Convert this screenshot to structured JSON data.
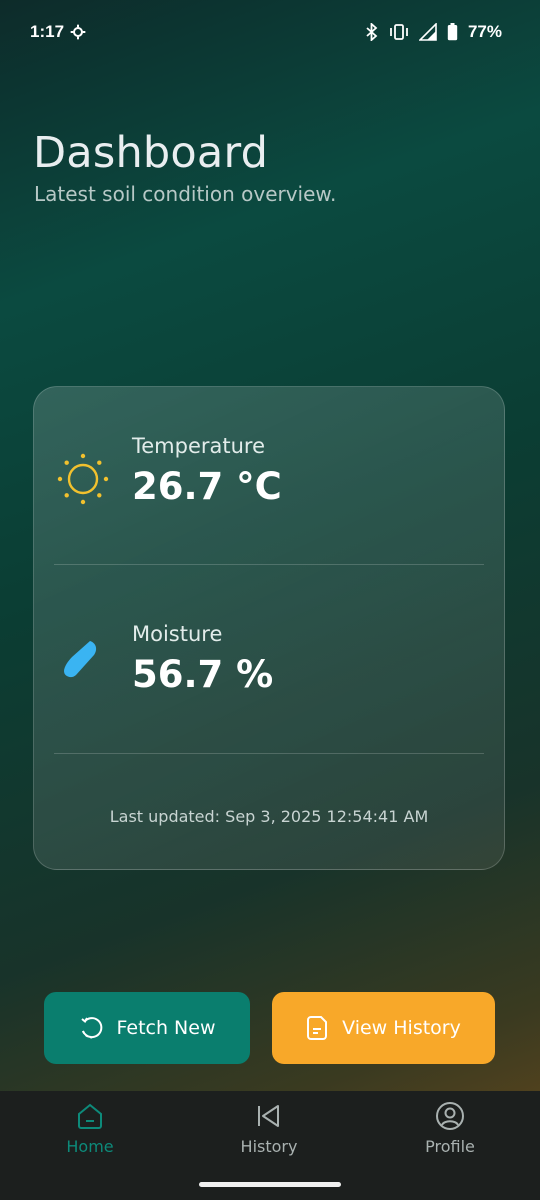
{
  "status_bar": {
    "time": "1:17",
    "battery": "77%",
    "icons": [
      "settings-gear-icon",
      "bluetooth-icon",
      "vibrate-icon",
      "signal-icon",
      "battery-icon"
    ]
  },
  "header": {
    "title": "Dashboard",
    "subtitle": "Latest soil condition overview."
  },
  "card": {
    "temperature": {
      "label": "Temperature",
      "value": "26.7 °C",
      "icon": "sun-icon",
      "color": "#f2c12e"
    },
    "moisture": {
      "label": "Moisture",
      "value": "56.7 %",
      "icon": "water-drop-icon",
      "color": "#3ab4f2"
    },
    "last_updated": "Last updated: Sep 3, 2025 12:54:41 AM"
  },
  "actions": {
    "fetch": {
      "label": "Fetch New",
      "icon": "refresh-icon",
      "color": "#0a7e6e"
    },
    "history": {
      "label": "View History",
      "icon": "document-icon",
      "color": "#f8a829"
    }
  },
  "bottom_nav": {
    "items": [
      {
        "label": "Home",
        "icon": "home-icon",
        "active": true
      },
      {
        "label": "History",
        "icon": "skip-back-icon",
        "active": false
      },
      {
        "label": "Profile",
        "icon": "user-circle-icon",
        "active": false
      }
    ],
    "accent": "#0d8a7a"
  }
}
